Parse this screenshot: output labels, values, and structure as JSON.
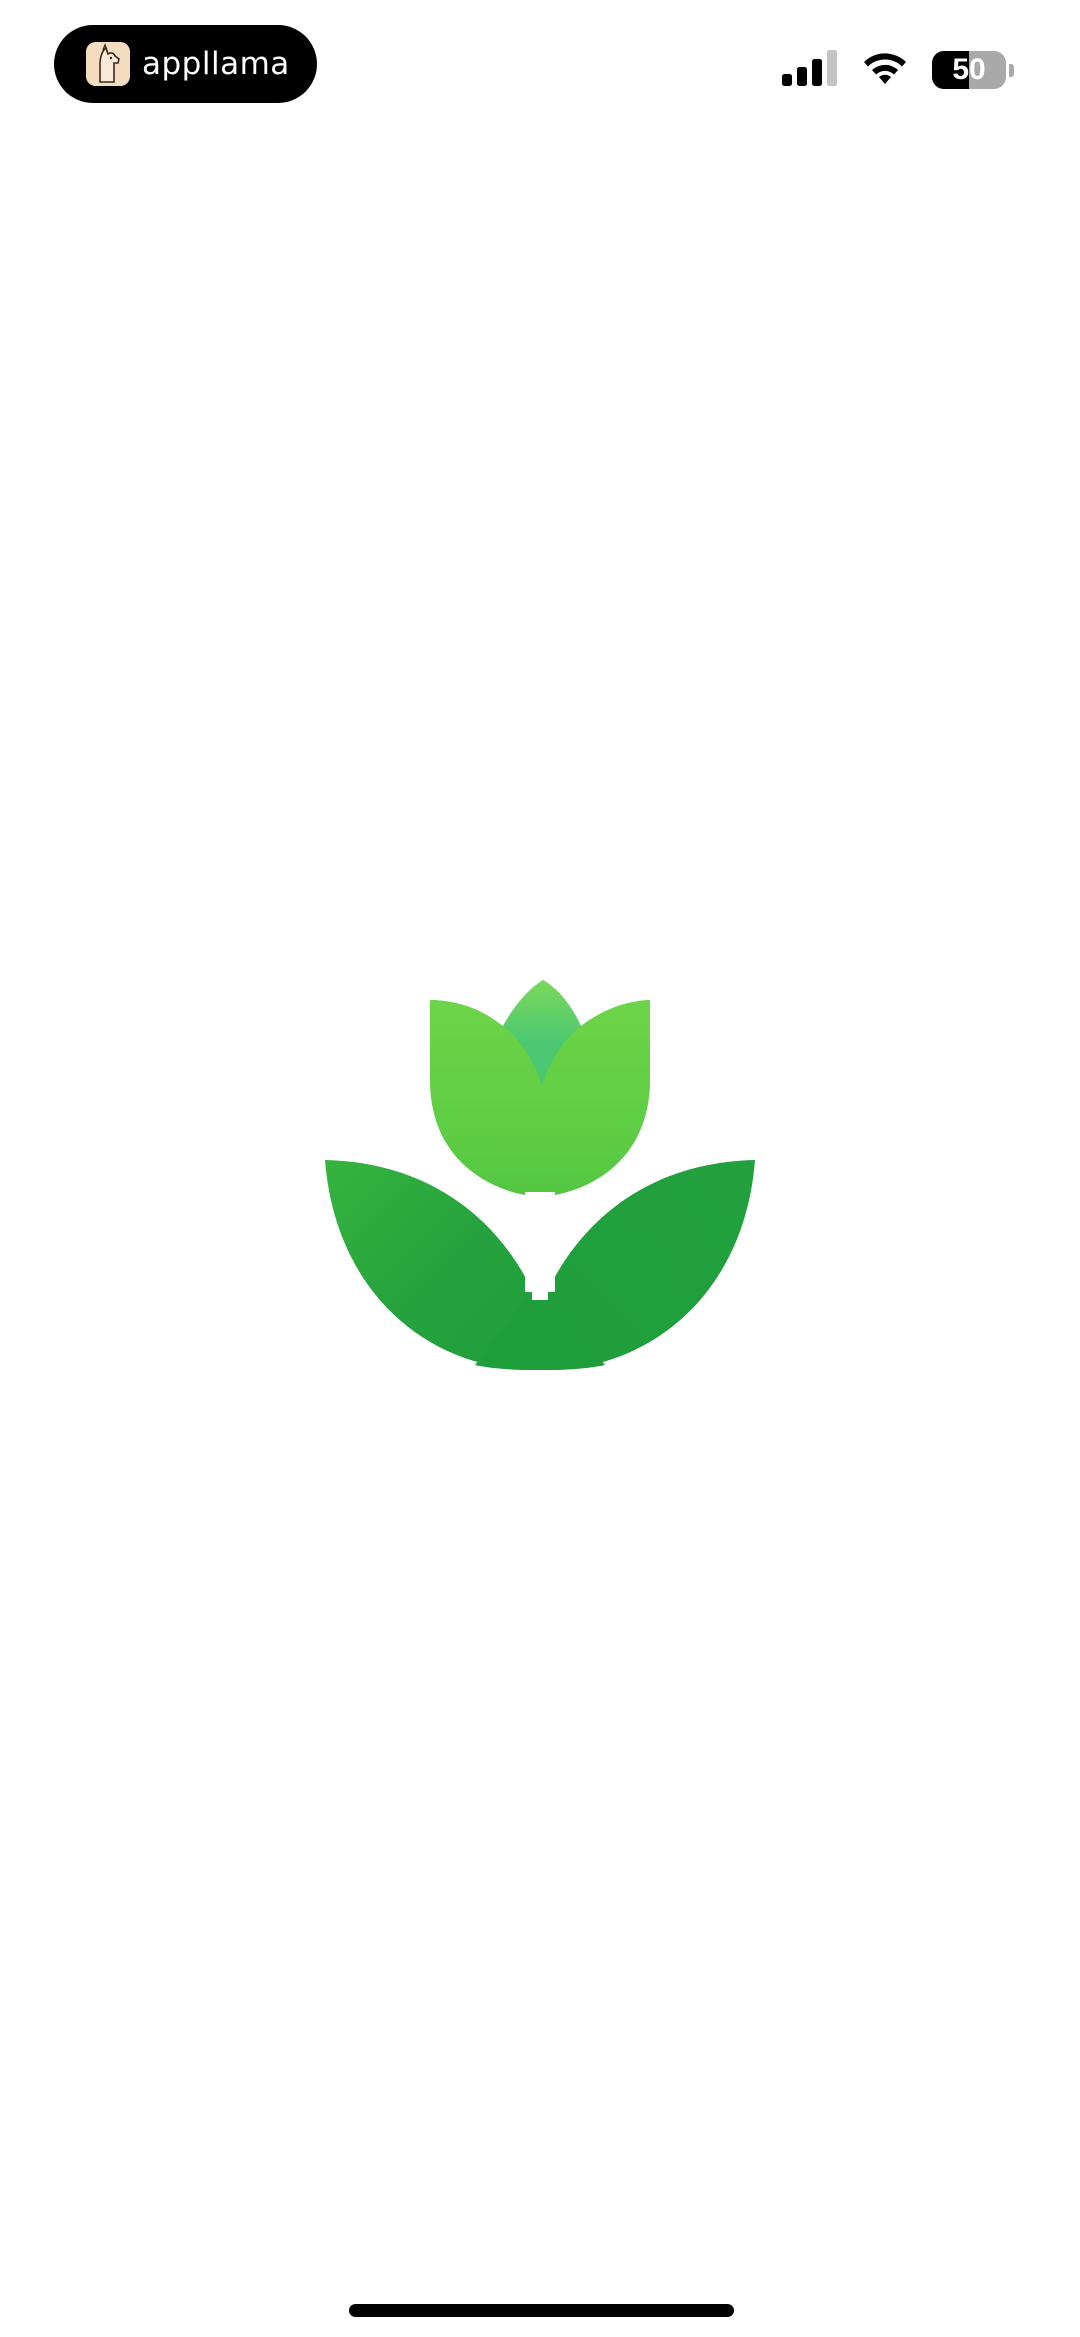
{
  "status_bar": {
    "app_pill": {
      "name": "appllama",
      "icon": "llama-icon"
    },
    "signal": {
      "icon": "cellular-signal-icon",
      "bars_active": 3,
      "bars_total": 4
    },
    "wifi": {
      "icon": "wifi-icon"
    },
    "battery": {
      "level_text": "50",
      "level_percent": 50,
      "icon": "battery-icon"
    }
  },
  "splash": {
    "logo_icon": "tulip-plant-icon",
    "colors": {
      "leaf_dark": "#22a03e",
      "petal_light": "#6fd548",
      "petal_center": "#4cc873"
    }
  },
  "home_indicator": {
    "icon": "home-indicator"
  }
}
